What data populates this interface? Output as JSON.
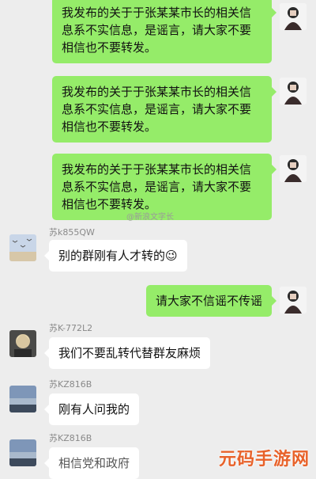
{
  "messages": [
    {
      "side": "right",
      "text": "我发布的关于于张某某市长的相关信息系不实信息，是谣言，请大家不要相信也不要转发。"
    },
    {
      "side": "right",
      "text": "我发布的关于于张某某市长的相关信息系不实信息，是谣言，请大家不要相信也不要转发。"
    },
    {
      "side": "right",
      "text": "我发布的关于于张某某市长的相关信息系不实信息，是谣言，请大家不要相信也不要转发。"
    },
    {
      "side": "left",
      "sender": "苏k855QW",
      "text": "别的群刚有人才转的😉"
    },
    {
      "side": "right",
      "text": "请大家不信谣不传谣"
    },
    {
      "side": "left",
      "sender": "苏K-772L2",
      "text": "我们不要乱转代替群友麻烦"
    },
    {
      "side": "left",
      "sender": "苏KZ816B",
      "text": "刚有人问我的"
    },
    {
      "side": "left",
      "sender": "苏KZ816B",
      "text": "相信党和政府"
    }
  ],
  "watermark": "@新浪文字长",
  "brand": "元码手游网",
  "colors": {
    "outgoing": "#95ec69",
    "incoming": "#ffffff",
    "background": "#ededed",
    "brand": "#e8622a"
  }
}
